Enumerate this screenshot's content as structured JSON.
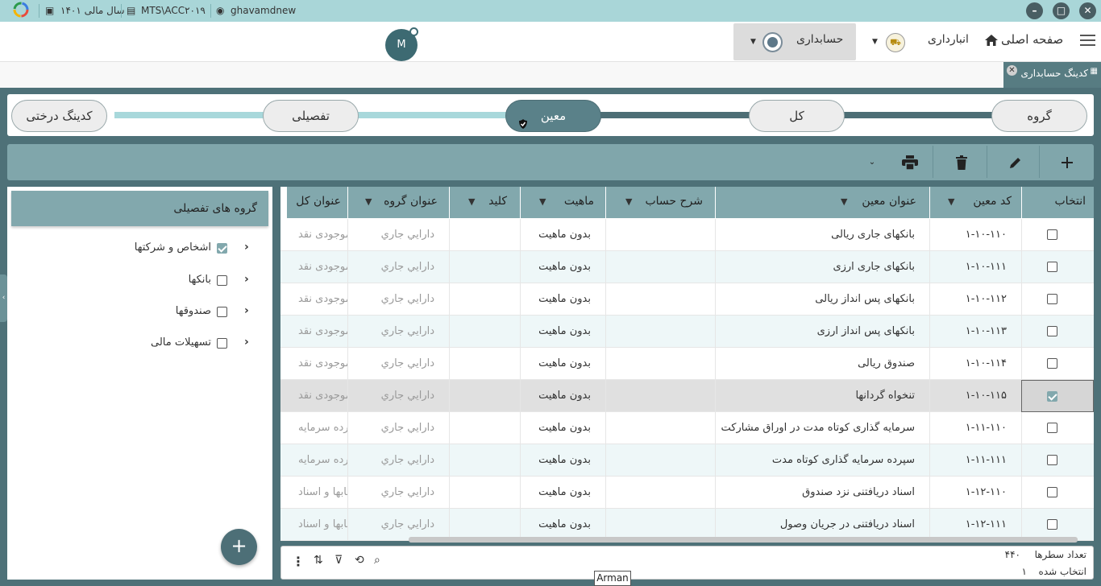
{
  "titlebar": {
    "user": "ghavamdnew",
    "database": "MTS\\ACC۲۰۱۹",
    "fiscal_year": "سال مالی ۱۴۰۱"
  },
  "topbar": {
    "home_label": "صفحه اصلی",
    "store_label": "انبارداری",
    "accounting_label": "حسابداری",
    "avatar_letter": "M"
  },
  "tab": {
    "label": "کدینگ حسابداری"
  },
  "stepper": {
    "steps": [
      "گروه",
      "کل",
      "معین",
      "تفصیلی",
      "کدینگ درختی"
    ],
    "active": "معین"
  },
  "side_panel": {
    "header": "گروه های تفصیلی",
    "items": [
      {
        "label": "اشخاص و شرکتها",
        "checked": true
      },
      {
        "label": "بانکها",
        "checked": false
      },
      {
        "label": "صندوقها",
        "checked": false
      },
      {
        "label": "تسهیلات مالی",
        "checked": false
      }
    ]
  },
  "grid": {
    "columns": {
      "select": "انتخاب",
      "code": "کد معین",
      "title": "عنوان معین",
      "description": "شرح حساب",
      "nature": "ماهیت",
      "key": "کلید",
      "group_title": "عنوان گروه",
      "general_title": "عنوان کل"
    },
    "rows": [
      {
        "code": "۱-۱۰-۱۱۰",
        "title": "بانکهای جاری ریالی",
        "nature": "بدون ماهیت",
        "group": "دارايي جاري",
        "general": "موجودی نقد",
        "selected": false
      },
      {
        "code": "۱-۱۰-۱۱۱",
        "title": "بانکهای جاری ارزی",
        "nature": "بدون ماهیت",
        "group": "دارايي جاري",
        "general": "موجودی نقد",
        "selected": false
      },
      {
        "code": "۱-۱۰-۱۱۲",
        "title": "بانکهای پس انداز ریالی",
        "nature": "بدون ماهیت",
        "group": "دارايي جاري",
        "general": "موجودی نقد",
        "selected": false
      },
      {
        "code": "۱-۱۰-۱۱۳",
        "title": "بانکهای پس انداز ارزی",
        "nature": "بدون ماهیت",
        "group": "دارايي جاري",
        "general": "موجودی نقد",
        "selected": false
      },
      {
        "code": "۱-۱۰-۱۱۴",
        "title": "صندوق ریالی",
        "nature": "بدون ماهیت",
        "group": "دارايي جاري",
        "general": "موجودی نقد",
        "selected": false
      },
      {
        "code": "۱-۱۰-۱۱۵",
        "title": "تنخواه گردانها",
        "nature": "بدون ماهیت",
        "group": "دارايي جاري",
        "general": "موجودی نقد",
        "selected": true
      },
      {
        "code": "۱-۱۱-۱۱۰",
        "title": "سرمایه گذاری کوتاه مدت در اوراق مشارکت",
        "nature": "بدون ماهیت",
        "group": "دارايي جاري",
        "general": "سپرده سرمایه",
        "selected": false
      },
      {
        "code": "۱-۱۱-۱۱۱",
        "title": "سپرده سرمایه گذاری کوتاه مدت",
        "nature": "بدون ماهیت",
        "group": "دارايي جاري",
        "general": "سپرده سرمایه",
        "selected": false
      },
      {
        "code": "۱-۱۲-۱۱۰",
        "title": "اسناد دریافتنی نزد صندوق",
        "nature": "بدون ماهیت",
        "group": "دارايي جاري",
        "general": "حسابها و اسناد",
        "selected": false
      },
      {
        "code": "۱-۱۲-۱۱۱",
        "title": "اسناد دریافتنی در جریان وصول",
        "nature": "بدون ماهیت",
        "group": "دارايي جاري",
        "general": "حسابها و اسناد",
        "selected": false
      }
    ]
  },
  "footer": {
    "row_count_label": "تعداد سطرها",
    "row_count": "۴۴۰",
    "selected_label": "انتخاب شده",
    "selected_count": "۱"
  },
  "tooltip": "Arman",
  "icons": {
    "menu": "hamburger-icon",
    "home": "home-icon",
    "add": "plus-icon",
    "edit": "pencil-icon",
    "delete": "trash-icon",
    "print": "printer-icon"
  }
}
